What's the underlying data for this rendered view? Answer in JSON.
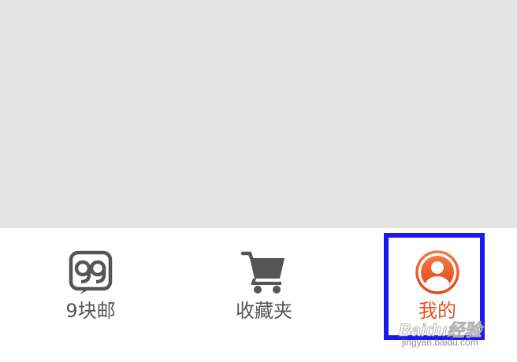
{
  "tabs": [
    {
      "label": "9块邮",
      "icon": "nine-nine-icon",
      "active": false
    },
    {
      "label": "收藏夹",
      "icon": "shopping-cart-icon",
      "active": false
    },
    {
      "label": "我的",
      "icon": "user-profile-icon",
      "active": true
    }
  ],
  "watermark": {
    "brand": "Baidu经验",
    "url": "jingyan.baidu.com"
  },
  "colors": {
    "active": "#e8501f",
    "inactive": "#555555",
    "content_bg": "#e4e4e4",
    "highlight": "#1a1aee"
  }
}
